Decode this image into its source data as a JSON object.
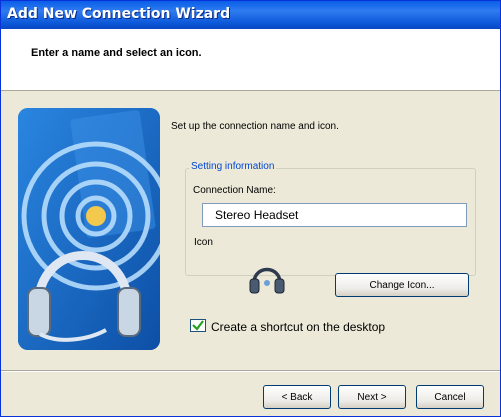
{
  "window": {
    "title": "Add New Connection Wizard"
  },
  "header": {
    "title": "Enter a name and select an icon."
  },
  "main": {
    "description": "Set up the connection name and icon.",
    "group_label": "Setting information",
    "connection_name_label": "Connection Name:",
    "connection_name_value": "Stereo Headset",
    "icon_label": "Icon",
    "change_icon_button": "Change Icon...",
    "shortcut_label": "Create a shortcut on the desktop",
    "shortcut_checked": true
  },
  "footer": {
    "back_button": "< Back",
    "next_button": "Next >",
    "cancel_button": "Cancel"
  },
  "colors": {
    "titlebar": "#0a5fe8",
    "group_label": "#0046d5",
    "art_bg": "#1a6fc7"
  },
  "icons": [
    "headset-illustration",
    "headset-icon",
    "checkbox-icon"
  ]
}
